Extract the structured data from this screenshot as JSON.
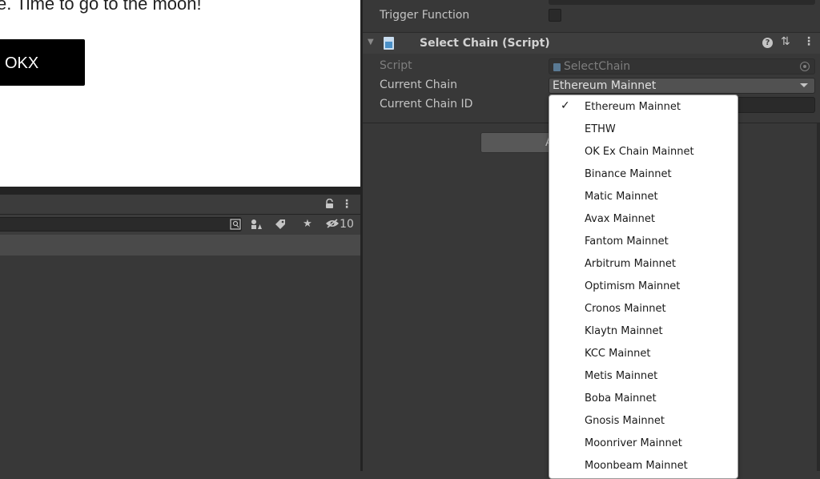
{
  "game_view": {
    "tagline": "e. Time to go to the moon!",
    "okx_button_label": "OKX"
  },
  "left_panel": {
    "hidden_count": "10",
    "icons": [
      "lock-icon",
      "kebab-menu-icon",
      "search-by-type-icon",
      "scene-visibility-icon",
      "label-icon",
      "favorite-star-icon",
      "hidden-count-eye-icon"
    ]
  },
  "inspector": {
    "trigger_label": "Trigger Function",
    "component": {
      "title": "Select Chain (Script)",
      "icons": [
        "fold-arrow-icon",
        "script-icon",
        "help-icon",
        "preset-icon",
        "kebab-menu-icon"
      ]
    },
    "fields": {
      "script_label": "Script",
      "script_value": "SelectChain",
      "current_chain_label": "Current Chain",
      "current_chain_value": "Ethereum Mainnet",
      "chain_id_label": "Current Chain ID"
    },
    "add_component_label": "A"
  },
  "chain_popup": {
    "check_mark": "✓",
    "selected": "Ethereum Mainnet",
    "options": [
      "Ethereum Mainnet",
      "ETHW",
      "OK Ex Chain Mainnet",
      "Binance Mainnet",
      "Matic Mainnet",
      "Avax Mainnet",
      "Fantom Mainnet",
      "Arbitrum Mainnet",
      "Optimism Mainnet",
      "Cronos Mainnet",
      "Klaytn Mainnet",
      "KCC Mainnet",
      "Metis Mainnet",
      "Boba Mainnet",
      "Gnosis Mainnet",
      "Moonriver Mainnet",
      "Moonbeam Mainnet"
    ]
  }
}
